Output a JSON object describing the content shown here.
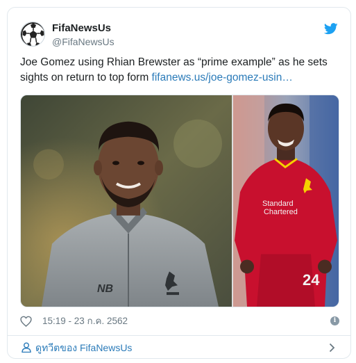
{
  "tweet": {
    "display_name": "FifaNewsUs",
    "handle": "@FifaNewsUs",
    "text": "Joe Gomez using Rhian Brewster as “prime example” as he sets sights on return to top form ",
    "link_text": "fifanews.us/joe-gomez-usin…",
    "timestamp": "15:19 - 23 ก.ค. 2562"
  },
  "footer": {
    "view_tweets_label": "ดูทวีตของ FifaNewsUs"
  },
  "icons": {
    "avatar": "soccer-ball-icon",
    "brand": "twitter-bird-icon",
    "like": "heart-icon",
    "info": "info-icon",
    "profile": "person-icon",
    "navigate": "chevron-right-icon"
  },
  "images": {
    "left_photo_jersey_text": "NB",
    "right_photo_sponsor_line1": "Standard",
    "right_photo_sponsor_line2": "Chartered",
    "right_photo_number": "24"
  },
  "colors": {
    "link": "#2b7bb9",
    "twitter_blue": "#1da1f2",
    "muted_text": "#697882",
    "border": "#e1e8ed",
    "liverpool_red": "#c8102e"
  }
}
